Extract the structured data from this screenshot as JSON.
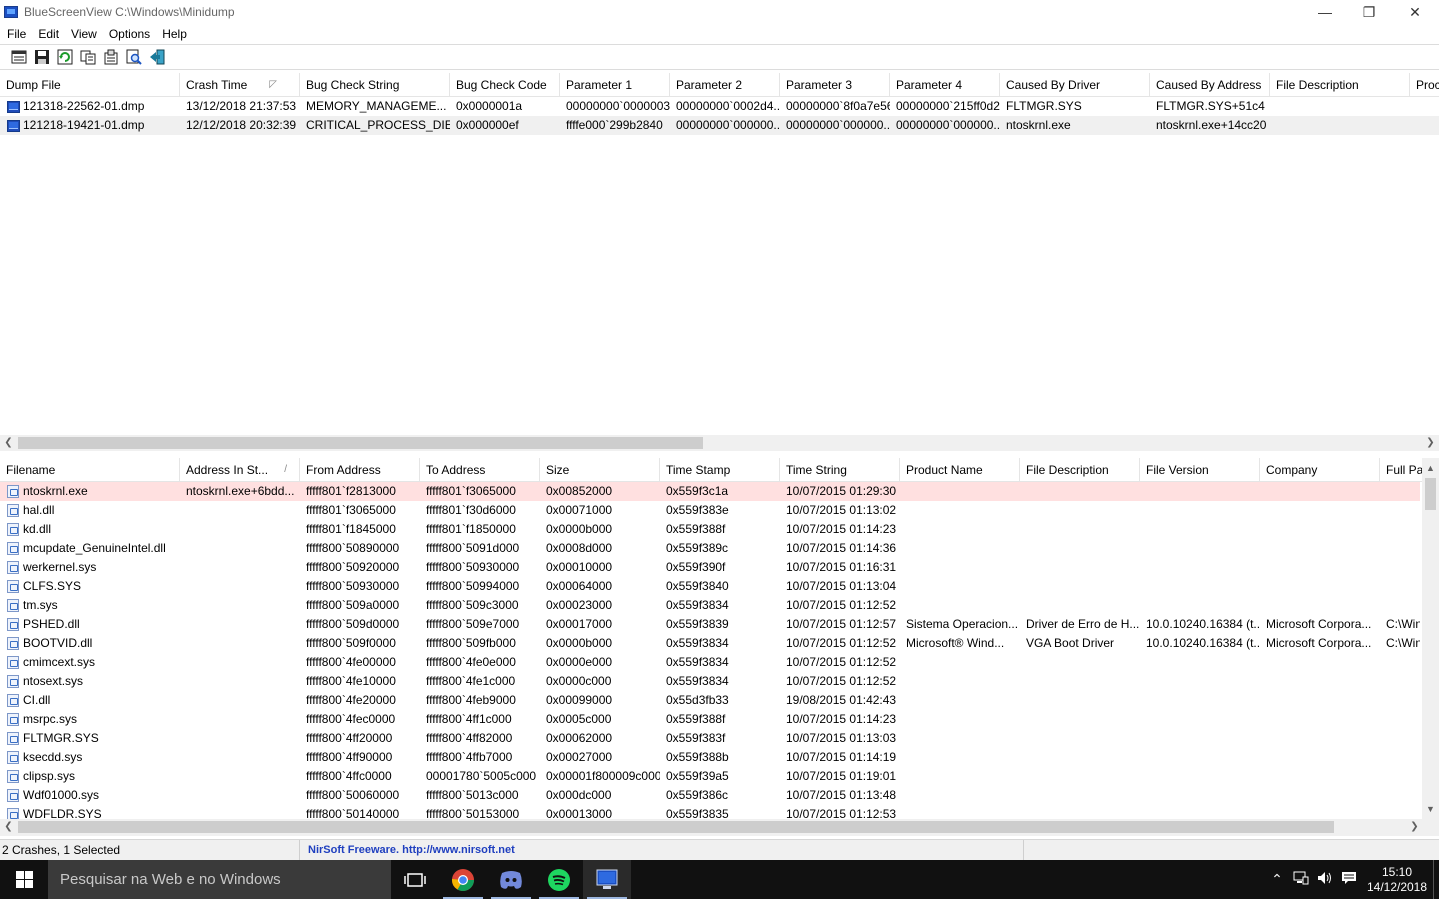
{
  "window": {
    "title": "BlueScreenView    C:\\Windows\\Minidump",
    "min_glyph": "—",
    "max_glyph": "❐",
    "close_glyph": "✕"
  },
  "menu": [
    "File",
    "Edit",
    "View",
    "Options",
    "Help"
  ],
  "toolbar_icons": [
    "properties-icon",
    "save-icon",
    "refresh-icon",
    "copy-icon",
    "html-report-icon",
    "find-icon",
    "exit-icon"
  ],
  "crash_list": {
    "columns": [
      {
        "label": "Dump File",
        "w": 180
      },
      {
        "label": "Crash Time",
        "w": 120
      },
      {
        "label": "Bug Check String",
        "w": 150
      },
      {
        "label": "Bug Check Code",
        "w": 110
      },
      {
        "label": "Parameter 1",
        "w": 110
      },
      {
        "label": "Parameter 2",
        "w": 110
      },
      {
        "label": "Parameter 3",
        "w": 110
      },
      {
        "label": "Parameter 4",
        "w": 110
      },
      {
        "label": "Caused By Driver",
        "w": 150
      },
      {
        "label": "Caused By Address",
        "w": 120
      },
      {
        "label": "File Description",
        "w": 140
      },
      {
        "label": "Proc",
        "w": 40
      }
    ],
    "sort_glyph": "◸",
    "rows": [
      [
        "121318-22562-01.dmp",
        "13/12/2018 21:37:53",
        "MEMORY_MANAGEME...",
        "0x0000001a",
        "00000000`0000003f",
        "00000000`0002d4...",
        "00000000`8f0a7e56",
        "00000000`215ff0d2",
        "FLTMGR.SYS",
        "FLTMGR.SYS+51c4",
        "",
        ""
      ],
      [
        "121218-19421-01.dmp",
        "12/12/2018 20:32:39",
        "CRITICAL_PROCESS_DIED",
        "0x000000ef",
        "ffffe000`299b2840",
        "00000000`000000...",
        "00000000`000000...",
        "00000000`000000...",
        "ntoskrnl.exe",
        "ntoskrnl.exe+14cc20",
        "",
        ""
      ]
    ]
  },
  "module_list": {
    "columns": [
      {
        "label": "Filename",
        "w": 180
      },
      {
        "label": "Address In St...",
        "w": 120
      },
      {
        "label": "From Address",
        "w": 120
      },
      {
        "label": "To Address",
        "w": 120
      },
      {
        "label": "Size",
        "w": 120
      },
      {
        "label": "Time Stamp",
        "w": 120
      },
      {
        "label": "Time String",
        "w": 120
      },
      {
        "label": "Product Name",
        "w": 120
      },
      {
        "label": "File Description",
        "w": 120
      },
      {
        "label": "File Version",
        "w": 120
      },
      {
        "label": "Company",
        "w": 120
      },
      {
        "label": "Full Pa",
        "w": 40
      }
    ],
    "sort_glyph": "/",
    "rows": [
      [
        "ntoskrnl.exe",
        "ntoskrnl.exe+6bdd...",
        "fffff801`f2813000",
        "fffff801`f3065000",
        "0x00852000",
        "0x559f3c1a",
        "10/07/2015 01:29:30",
        "",
        "",
        "",
        "",
        ""
      ],
      [
        "hal.dll",
        "",
        "fffff801`f3065000",
        "fffff801`f30d6000",
        "0x00071000",
        "0x559f383e",
        "10/07/2015 01:13:02",
        "",
        "",
        "",
        "",
        ""
      ],
      [
        "kd.dll",
        "",
        "fffff801`f1845000",
        "fffff801`f1850000",
        "0x0000b000",
        "0x559f388f",
        "10/07/2015 01:14:23",
        "",
        "",
        "",
        "",
        ""
      ],
      [
        "mcupdate_GenuineIntel.dll",
        "",
        "fffff800`50890000",
        "fffff800`5091d000",
        "0x0008d000",
        "0x559f389c",
        "10/07/2015 01:14:36",
        "",
        "",
        "",
        "",
        ""
      ],
      [
        "werkernel.sys",
        "",
        "fffff800`50920000",
        "fffff800`50930000",
        "0x00010000",
        "0x559f390f",
        "10/07/2015 01:16:31",
        "",
        "",
        "",
        "",
        ""
      ],
      [
        "CLFS.SYS",
        "",
        "fffff800`50930000",
        "fffff800`50994000",
        "0x00064000",
        "0x559f3840",
        "10/07/2015 01:13:04",
        "",
        "",
        "",
        "",
        ""
      ],
      [
        "tm.sys",
        "",
        "fffff800`509a0000",
        "fffff800`509c3000",
        "0x00023000",
        "0x559f3834",
        "10/07/2015 01:12:52",
        "",
        "",
        "",
        "",
        ""
      ],
      [
        "PSHED.dll",
        "",
        "fffff800`509d0000",
        "fffff800`509e7000",
        "0x00017000",
        "0x559f3839",
        "10/07/2015 01:12:57",
        "Sistema Operacion...",
        "Driver de Erro de H...",
        "10.0.10240.16384 (t...",
        "Microsoft Corpora...",
        "C:\\Win"
      ],
      [
        "BOOTVID.dll",
        "",
        "fffff800`509f0000",
        "fffff800`509fb000",
        "0x0000b000",
        "0x559f3834",
        "10/07/2015 01:12:52",
        "Microsoft® Wind...",
        "VGA Boot Driver",
        "10.0.10240.16384 (t...",
        "Microsoft Corpora...",
        "C:\\Win"
      ],
      [
        "cmimcext.sys",
        "",
        "fffff800`4fe00000",
        "fffff800`4fe0e000",
        "0x0000e000",
        "0x559f3834",
        "10/07/2015 01:12:52",
        "",
        "",
        "",
        "",
        ""
      ],
      [
        "ntosext.sys",
        "",
        "fffff800`4fe10000",
        "fffff800`4fe1c000",
        "0x0000c000",
        "0x559f3834",
        "10/07/2015 01:12:52",
        "",
        "",
        "",
        "",
        ""
      ],
      [
        "CI.dll",
        "",
        "fffff800`4fe20000",
        "fffff800`4feb9000",
        "0x00099000",
        "0x55d3fb33",
        "19/08/2015 01:42:43",
        "",
        "",
        "",
        "",
        ""
      ],
      [
        "msrpc.sys",
        "",
        "fffff800`4fec0000",
        "fffff800`4ff1c000",
        "0x0005c000",
        "0x559f388f",
        "10/07/2015 01:14:23",
        "",
        "",
        "",
        "",
        ""
      ],
      [
        "FLTMGR.SYS",
        "",
        "fffff800`4ff20000",
        "fffff800`4ff82000",
        "0x00062000",
        "0x559f383f",
        "10/07/2015 01:13:03",
        "",
        "",
        "",
        "",
        ""
      ],
      [
        "ksecdd.sys",
        "",
        "fffff800`4ff90000",
        "fffff800`4ffb7000",
        "0x00027000",
        "0x559f388b",
        "10/07/2015 01:14:19",
        "",
        "",
        "",
        "",
        ""
      ],
      [
        "clipsp.sys",
        "",
        "fffff800`4ffc0000",
        "00001780`5005c000",
        "0x00001f800009c000",
        "0x559f39a5",
        "10/07/2015 01:19:01",
        "",
        "",
        "",
        "",
        ""
      ],
      [
        "Wdf01000.sys",
        "",
        "fffff800`50060000",
        "fffff800`5013c000",
        "0x000dc000",
        "0x559f386c",
        "10/07/2015 01:13:48",
        "",
        "",
        "",
        "",
        ""
      ],
      [
        "WDFLDR.SYS",
        "",
        "fffff800`50140000",
        "fffff800`50153000",
        "0x00013000",
        "0x559f3835",
        "10/07/2015 01:12:53",
        "",
        "",
        "",
        "",
        ""
      ]
    ]
  },
  "status": {
    "crashes": "2 Crashes, 1 Selected",
    "nirsoft": "NirSoft Freeware.  http://www.nirsoft.net"
  },
  "taskbar": {
    "search_placeholder": "Pesquisar na Web e no Windows",
    "time": "15:10",
    "date": "14/12/2018"
  },
  "colors": {
    "selected_pink": "#ffe0e0",
    "selected_gray": "#f0f0f0",
    "nirsoft_blue": "#1f3fbf",
    "taskbar": "#111111"
  }
}
